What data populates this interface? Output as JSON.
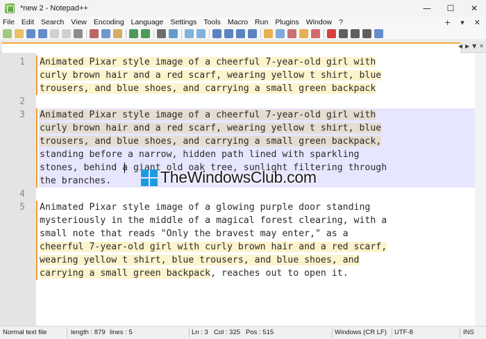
{
  "window": {
    "title": "*new 2 - Notepad++",
    "minimize_glyph": "—",
    "maximize_glyph": "☐",
    "close_glyph": "✕"
  },
  "menu": {
    "items": [
      "File",
      "Edit",
      "Search",
      "View",
      "Encoding",
      "Language",
      "Settings",
      "Tools",
      "Macro",
      "Run",
      "Plugins",
      "Window",
      "?"
    ],
    "add_glyph": "+",
    "dropdown_glyph": "▾",
    "close_glyph": "✕"
  },
  "toolbar": {
    "icons": [
      {
        "name": "new-file-icon",
        "color": "#8fc16b"
      },
      {
        "name": "open-file-icon",
        "color": "#e8b84a"
      },
      {
        "name": "save-icon",
        "color": "#4a78c2"
      },
      {
        "name": "save-all-icon",
        "color": "#4a78c2"
      },
      {
        "name": "close-file-icon",
        "color": "#c9c9c9"
      },
      {
        "name": "close-all-icon",
        "color": "#c9c9c9"
      },
      {
        "name": "print-icon",
        "color": "#7a7a7a"
      },
      {
        "name": "separator"
      },
      {
        "name": "cut-icon",
        "color": "#b04a4a"
      },
      {
        "name": "copy-icon",
        "color": "#5a86c7"
      },
      {
        "name": "paste-icon",
        "color": "#d0a24a"
      },
      {
        "name": "separator"
      },
      {
        "name": "undo-icon",
        "color": "#2e8a3a"
      },
      {
        "name": "redo-icon",
        "color": "#2e8a3a"
      },
      {
        "name": "separator"
      },
      {
        "name": "find-icon",
        "color": "#555555"
      },
      {
        "name": "replace-icon",
        "color": "#4c8cc4"
      },
      {
        "name": "separator"
      },
      {
        "name": "zoom-in-icon",
        "color": "#6aa7d8"
      },
      {
        "name": "zoom-out-icon",
        "color": "#6aa7d8"
      },
      {
        "name": "separator"
      },
      {
        "name": "sync-scroll-icon",
        "color": "#3f6fb8"
      },
      {
        "name": "word-wrap-icon",
        "color": "#3f6fb8"
      },
      {
        "name": "all-chars-icon",
        "color": "#3f6fb8"
      },
      {
        "name": "indent-guide-icon",
        "color": "#3f6fb8"
      },
      {
        "name": "separator"
      },
      {
        "name": "user-language-icon",
        "color": "#e3a535"
      },
      {
        "name": "document-map-icon",
        "color": "#6a9bd6"
      },
      {
        "name": "function-list-icon",
        "color": "#c05a5a"
      },
      {
        "name": "folder-workspace-icon",
        "color": "#e3a535"
      },
      {
        "name": "monitoring-icon",
        "color": "#d05050"
      },
      {
        "name": "separator"
      },
      {
        "name": "record-macro-icon",
        "color": "#d02020"
      },
      {
        "name": "stop-macro-icon",
        "color": "#444444"
      },
      {
        "name": "play-macro-icon",
        "color": "#444444"
      },
      {
        "name": "run-macro-multiple-icon",
        "color": "#444444"
      },
      {
        "name": "save-macro-icon",
        "color": "#4a78c2"
      }
    ]
  },
  "tabs": {
    "scroll_left_glyph": "◀",
    "scroll_right_glyph": "▶",
    "list_glyph": "▼",
    "close_glyph": "✕"
  },
  "editor": {
    "lines": [
      {
        "num": "1",
        "rows": [
          [
            {
              "t": "Animated Pixar style image of a cheerful 7-year-old girl with",
              "h": "hl"
            }
          ],
          [
            {
              "t": "curly brown hair and a red scarf, wearing yellow t shirt, blue",
              "h": "hl"
            }
          ],
          [
            {
              "t": "trousers, and blue shoes, and carrying a small green backpack",
              "h": "hl"
            }
          ]
        ]
      },
      {
        "num": "2",
        "rows": [
          [
            {
              "t": "",
              "h": ""
            }
          ]
        ]
      },
      {
        "num": "3",
        "current": true,
        "rows": [
          [
            {
              "t": "Animated Pixar style image of a cheerful 7-year-old girl with",
              "h": "hl-cur"
            }
          ],
          [
            {
              "t": "curly brown hair and a red scarf, wearing yellow t shirt, blue",
              "h": "hl-cur"
            }
          ],
          [
            {
              "t": "trousers, and blue shoes, and carrying a small green backpack,",
              "h": "hl-cur"
            }
          ],
          [
            {
              "t": "standing before a narrow, hidden path lined with sparkling",
              "h": ""
            }
          ],
          [
            {
              "t": "stones, behind a giant old oak tree, sunlight filtering through",
              "h": ""
            }
          ],
          [
            {
              "t": "the branches.",
              "h": ""
            }
          ]
        ]
      },
      {
        "num": "4",
        "rows": [
          [
            {
              "t": "",
              "h": ""
            }
          ]
        ]
      },
      {
        "num": "5",
        "rows": [
          [
            {
              "t": "Animated Pixar style image of a glowing purple door standing",
              "h": ""
            }
          ],
          [
            {
              "t": "mysteriously in the middle of a magical forest clearing, with a",
              "h": ""
            }
          ],
          [
            {
              "t": "small note that reads \"Only the bravest may enter,\" as a",
              "h": ""
            }
          ],
          [
            {
              "t": "cheerful 7-year-old girl with curly brown hair and a red scarf,",
              "h": "hl"
            }
          ],
          [
            {
              "t": "wearing yellow t shirt, blue trousers, and blue shoes, and",
              "h": "hl"
            }
          ],
          [
            {
              "t": "carrying a small green backpack",
              "h": "hl"
            },
            {
              "t": ", reaches out to open it.",
              "h": ""
            }
          ]
        ]
      }
    ]
  },
  "watermark": {
    "text": "TheWindowsClub.com",
    "color": "#1d9be0"
  },
  "status": {
    "file_type": "Normal text file",
    "length": "length : 879",
    "lines": "lines : 5",
    "ln": "Ln : 3",
    "col": "Col : 325",
    "pos": "Pos : 515",
    "eol": "Windows (CR LF)",
    "encoding": "UTF-8",
    "mode": "INS"
  },
  "colors": {
    "highlight": "#fdf3cc",
    "current_line": "#e7e6ff",
    "change_marker": "#f29b38",
    "tab_accent": "#f8a83a"
  }
}
